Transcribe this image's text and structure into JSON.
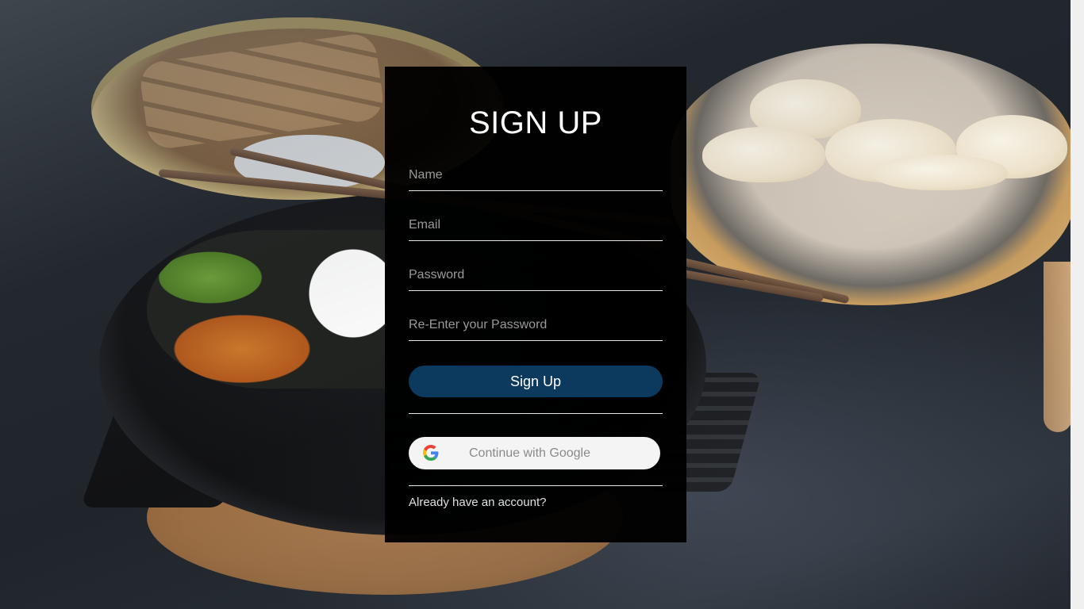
{
  "form": {
    "title": "SIGN UP",
    "fields": {
      "name": {
        "placeholder": "Name",
        "value": ""
      },
      "email": {
        "placeholder": "Email",
        "value": ""
      },
      "password": {
        "placeholder": "Password",
        "value": ""
      },
      "confirm_password": {
        "placeholder": "Re-Enter your Password",
        "value": ""
      }
    },
    "submit_label": "Sign Up",
    "google_label": "Continue with Google",
    "login_link": "Already have an account?"
  },
  "colors": {
    "card_background": "#000000",
    "submit_button": "#0b3a5e",
    "google_button": "#f4f4f4",
    "text_primary": "#ffffff",
    "placeholder": "#9a9a9a"
  },
  "icons": {
    "google": "google-icon"
  }
}
